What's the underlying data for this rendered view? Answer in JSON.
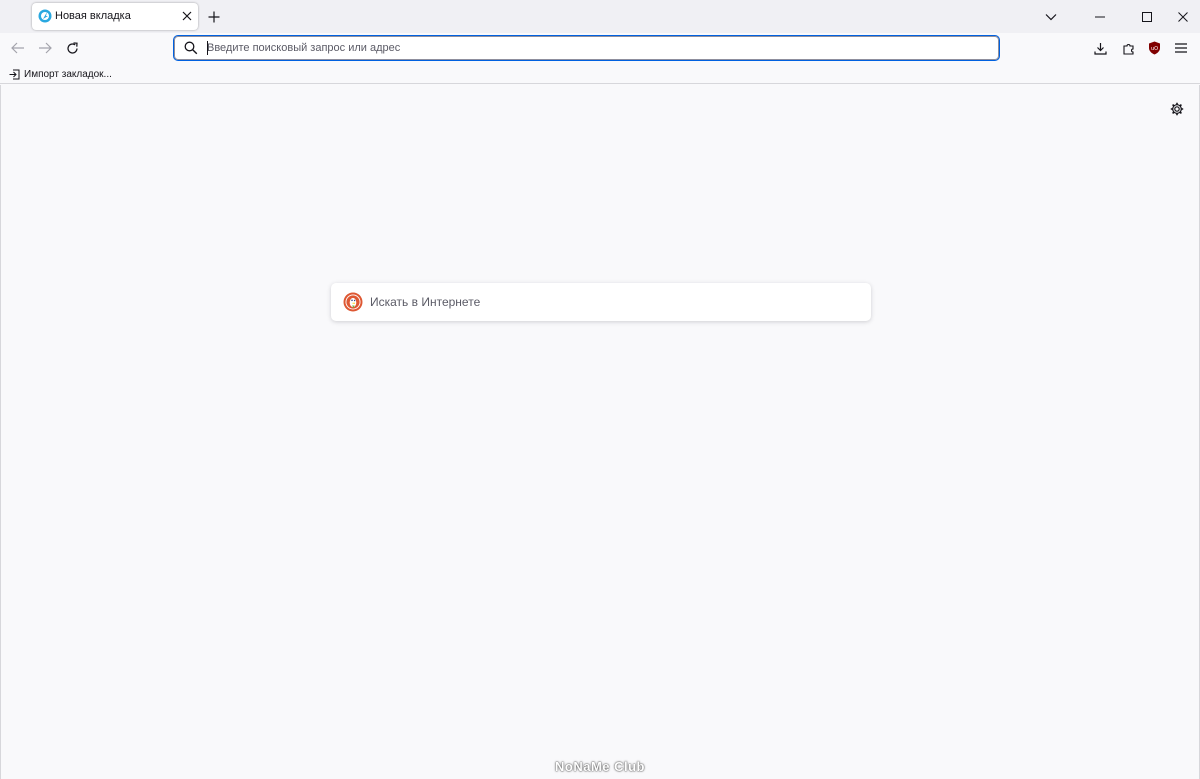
{
  "tabs": [
    {
      "title": "Новая вкладка",
      "active": true
    }
  ],
  "urlbar": {
    "placeholder": "Введите поисковый запрос или адрес",
    "value": ""
  },
  "bookmarks": {
    "items": [
      {
        "label": "Импорт закладок..."
      }
    ]
  },
  "newtab": {
    "search_placeholder": "Искать в Интернете",
    "search_engine_icon": "duckduckgo-icon"
  },
  "watermark": "NoNaMe Club",
  "colors": {
    "accent": "#0061e0",
    "tabstrip": "#f0f0f4",
    "page_background": "#f9f9fb",
    "ddg_orange": "#de5833"
  }
}
